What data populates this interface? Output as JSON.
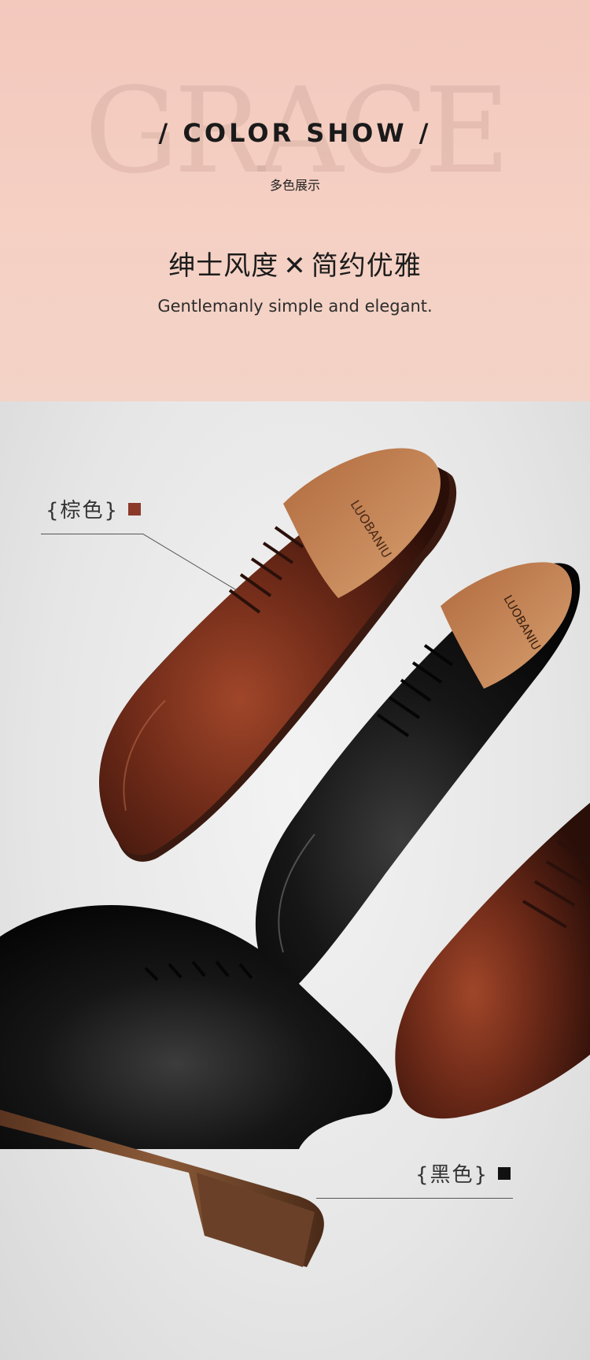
{
  "banner": {
    "watermark": "GRACE",
    "heading": "/ COLOR SHOW /",
    "subheading": "多色展示",
    "tagline_cn_left": "绅士风度",
    "tagline_cn_sep": "✕",
    "tagline_cn_right": "简约优雅",
    "tagline_en": "Gentlemanly simple and elegant."
  },
  "photo": {
    "brand_on_insole": "LUOBANIU",
    "labels": [
      {
        "text": "{棕色}",
        "swatch_color": "#8b3a2a"
      },
      {
        "text": "{黑色}",
        "swatch_color": "#111111"
      }
    ]
  },
  "colors": {
    "banner_top": "#f3c8bd",
    "brown_leather": "#6b2a1a",
    "black_leather": "#141414",
    "tan_lining": "#c98a5a"
  }
}
